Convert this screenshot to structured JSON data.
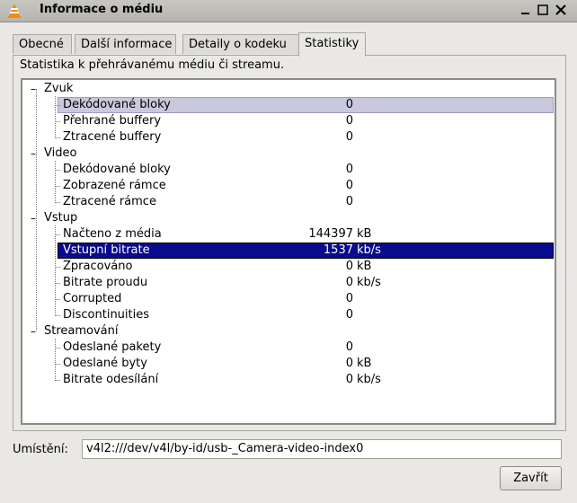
{
  "window": {
    "title": "Informace o médiu",
    "icon": "vlc-cone-icon",
    "controls": [
      "minimize-icon",
      "maximize-icon",
      "close-icon"
    ]
  },
  "tabs": [
    {
      "label": "Obecné",
      "active": false
    },
    {
      "label": "Další informace",
      "active": false
    },
    {
      "label": "Detaily o kodeku",
      "active": false
    },
    {
      "label": "Statistiky",
      "active": true
    }
  ],
  "description": "Statistika k přehrávanému médiu či streamu.",
  "tree": {
    "groups": [
      {
        "label": "Zvuk",
        "items": [
          {
            "label": "Dekódované bloky",
            "value": "0",
            "unit": "",
            "state": "hover"
          },
          {
            "label": "Přehrané buffery",
            "value": "0",
            "unit": ""
          },
          {
            "label": "Ztracené buffery",
            "value": "0",
            "unit": ""
          }
        ]
      },
      {
        "label": "Video",
        "items": [
          {
            "label": "Dekódované bloky",
            "value": "0",
            "unit": ""
          },
          {
            "label": "Zobrazené rámce",
            "value": "0",
            "unit": ""
          },
          {
            "label": "Ztracené rámce",
            "value": "0",
            "unit": ""
          }
        ]
      },
      {
        "label": "Vstup",
        "items": [
          {
            "label": "Načteno z média",
            "value": "144397",
            "unit": "kB"
          },
          {
            "label": "Vstupní bitrate",
            "value": "1537",
            "unit": "kb/s",
            "state": "selected"
          },
          {
            "label": "Zpracováno",
            "value": "0",
            "unit": "kB"
          },
          {
            "label": "Bitrate proudu",
            "value": "0",
            "unit": "kb/s"
          },
          {
            "label": "Corrupted",
            "value": "0",
            "unit": ""
          },
          {
            "label": "Discontinuities",
            "value": "0",
            "unit": ""
          }
        ]
      },
      {
        "label": "Streamování",
        "items": [
          {
            "label": "Odeslané pakety",
            "value": "0",
            "unit": ""
          },
          {
            "label": "Odeslané byty",
            "value": "0",
            "unit": "kB"
          },
          {
            "label": "Bitrate odesílání",
            "value": "0",
            "unit": "kb/s"
          }
        ]
      }
    ]
  },
  "location": {
    "label": "Umístění:",
    "value": "v4l2:///dev/v4l/by-id/usb-_Camera-video-index0"
  },
  "close_button": "Zavřít"
}
